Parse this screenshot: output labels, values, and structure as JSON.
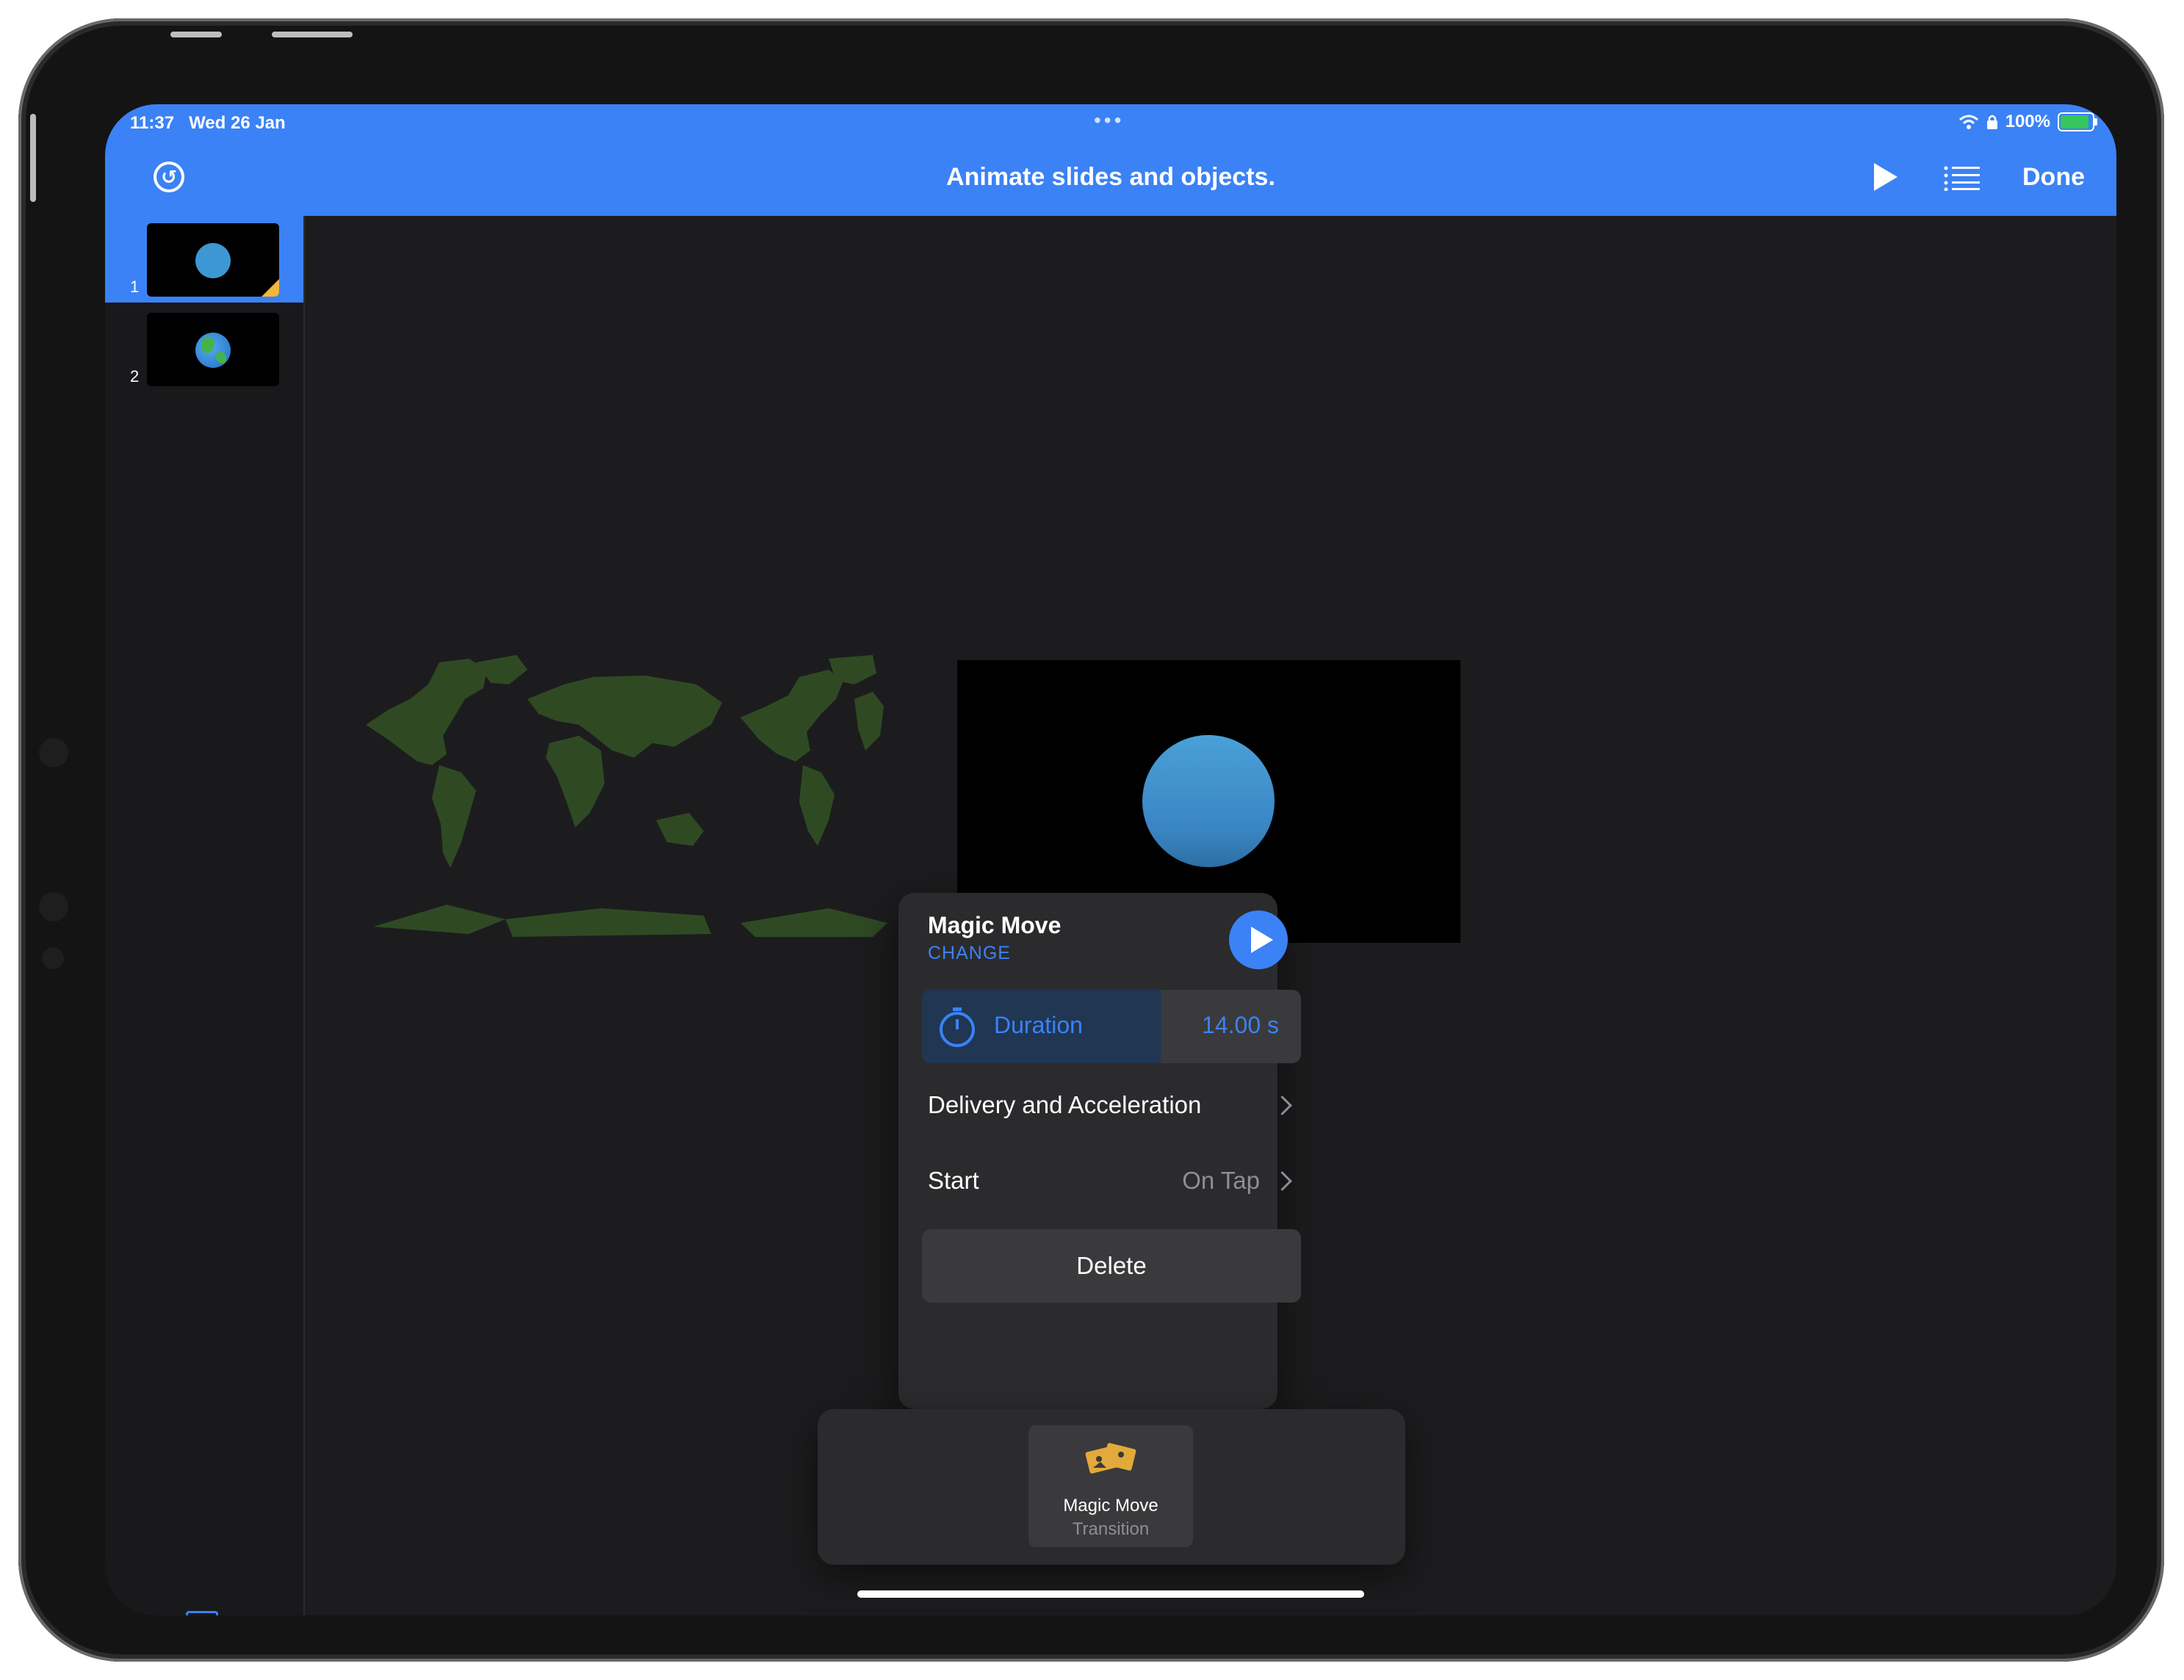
{
  "status_bar": {
    "time": "11:37",
    "date": "Wed 26 Jan",
    "dots": "•••",
    "battery_percent": "100%",
    "battery_level": 1.0
  },
  "toolbar": {
    "title": "Animate slides and objects.",
    "done_label": "Done",
    "undo_icon": "undo-icon",
    "play_icon": "play-icon",
    "list_icon": "list-icon"
  },
  "slides": [
    {
      "number": "1",
      "content": "blue-ball",
      "selected": true,
      "has_transition": true
    },
    {
      "number": "2",
      "content": "earth-emoji",
      "selected": false,
      "has_transition": false
    }
  ],
  "add_slide_label": "+",
  "popover": {
    "title": "Magic Move",
    "change_label": "CHANGE",
    "duration_label": "Duration",
    "duration_value": "14.00 s",
    "duration_fill": 0.63,
    "delivery_label": "Delivery and Acceleration",
    "start_label": "Start",
    "start_value": "On Tap",
    "delete_label": "Delete"
  },
  "transition_tray": {
    "item_label": "Magic Move",
    "item_sublabel": "Transition"
  },
  "colors": {
    "accent": "#3b82f6",
    "canvas": "#1c1c1e",
    "map_land": "#2f4a23",
    "ball": "#3d97d3",
    "transition_marker": "#f0b73e"
  }
}
